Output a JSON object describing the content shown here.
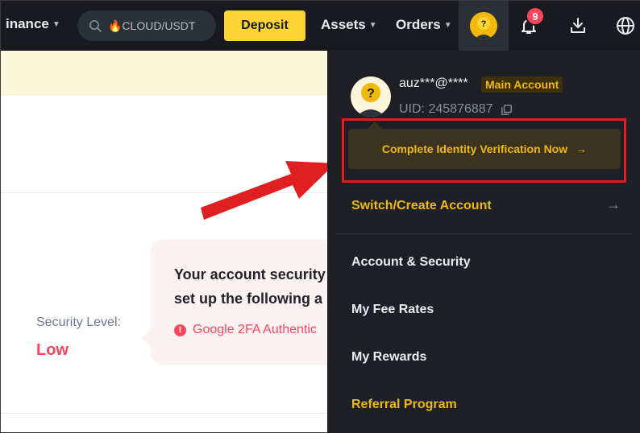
{
  "topbar": {
    "nav_finance": "inance",
    "search_placeholder": "🔥CLOUD/USDT",
    "deposit_label": "Deposit",
    "assets_label": "Assets",
    "orders_label": "Orders",
    "notification_count": "9"
  },
  "page": {
    "security_label": "Security Level:",
    "security_value": "Low",
    "tooltip_line1": "Your account security",
    "tooltip_line2": "set up the following a",
    "tooltip_warning": "Google 2FA Authentic"
  },
  "dropdown": {
    "email": "auz***@****",
    "account_badge": "Main Account",
    "uid": "UID: 245876887",
    "verify_label": "Complete Identity Verification Now",
    "verify_arrow": "→",
    "switch_label": "Switch/Create Account",
    "switch_arrow": "→",
    "items": [
      {
        "label": "Account & Security"
      },
      {
        "label": "My Fee Rates"
      },
      {
        "label": "My Rewards"
      },
      {
        "label": "Referral Program"
      }
    ]
  },
  "colors": {
    "brand_yellow": "#fcd535",
    "gold_text": "#f0b90b",
    "danger_red": "#f6465d",
    "annotation_red": "#e02020",
    "dark_bg": "#181a20"
  },
  "icons": [
    "search-icon",
    "caret-down-icon",
    "avatar-icon",
    "bell-icon",
    "download-icon",
    "globe-icon",
    "copy-icon",
    "arrow-right-icon",
    "warning-icon"
  ]
}
